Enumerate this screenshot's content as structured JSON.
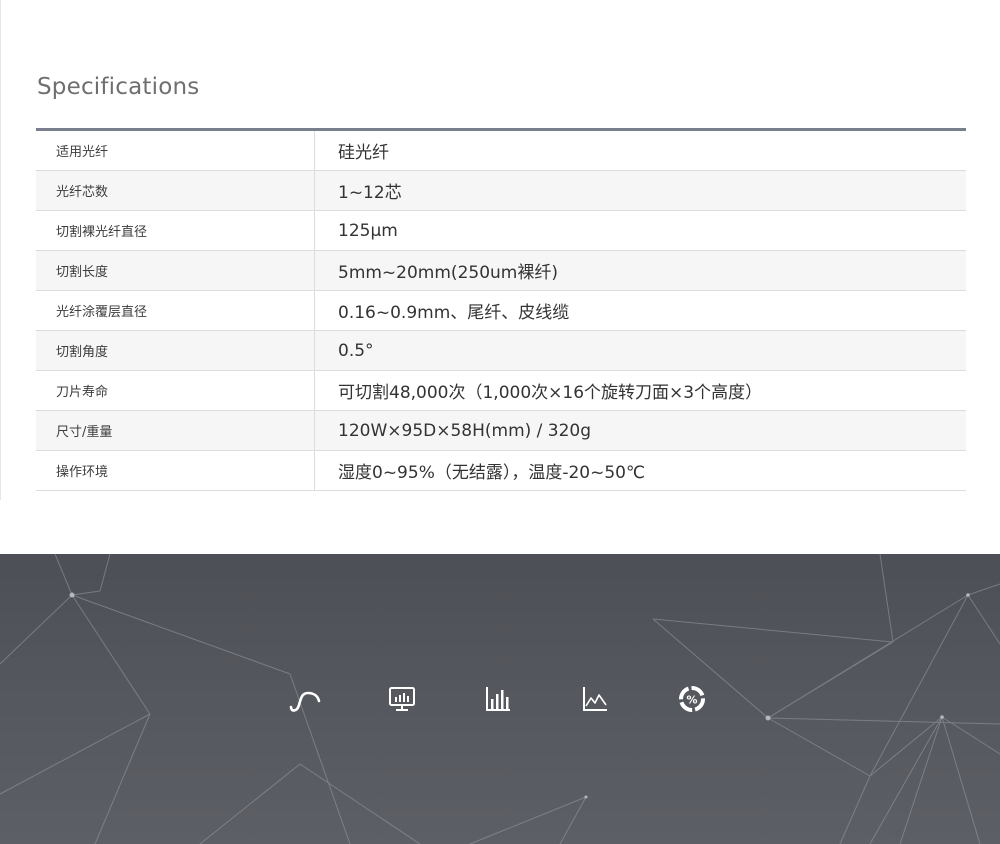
{
  "specs": {
    "title": "Specifications",
    "rows": [
      {
        "label": "适用光纤",
        "value": "硅光纤"
      },
      {
        "label": "光纤芯数",
        "value": "1~12芯"
      },
      {
        "label": "切割裸光纤直径",
        "value": "125μm"
      },
      {
        "label": "切割长度",
        "value": "5mm~20mm(250um裸纤)"
      },
      {
        "label": "光纤涂覆层直径",
        "value": "0.16~0.9mm、尾纤、皮线缆"
      },
      {
        "label": "切割角度",
        "value": "0.5°"
      },
      {
        "label": "刀片寿命",
        "value": "可切割48,000次（1,000次×16个旋转刀面×3个高度）"
      },
      {
        "label": "尺寸/重量",
        "value": "120W×95D×58H(mm) / 320g"
      },
      {
        "label": "操作环境",
        "value": "湿度0~95%（无结露），温度-20~50℃"
      }
    ]
  },
  "banner": {
    "icons": [
      "curve-icon",
      "monitor-chart-icon",
      "bar-chart-icon",
      "line-chart-icon",
      "percent-circle-icon"
    ],
    "percent_symbol": "%"
  },
  "colors": {
    "table_top_border": "#7a7f8e",
    "banner_bg": "#55575e",
    "icon": "#ffffff"
  }
}
